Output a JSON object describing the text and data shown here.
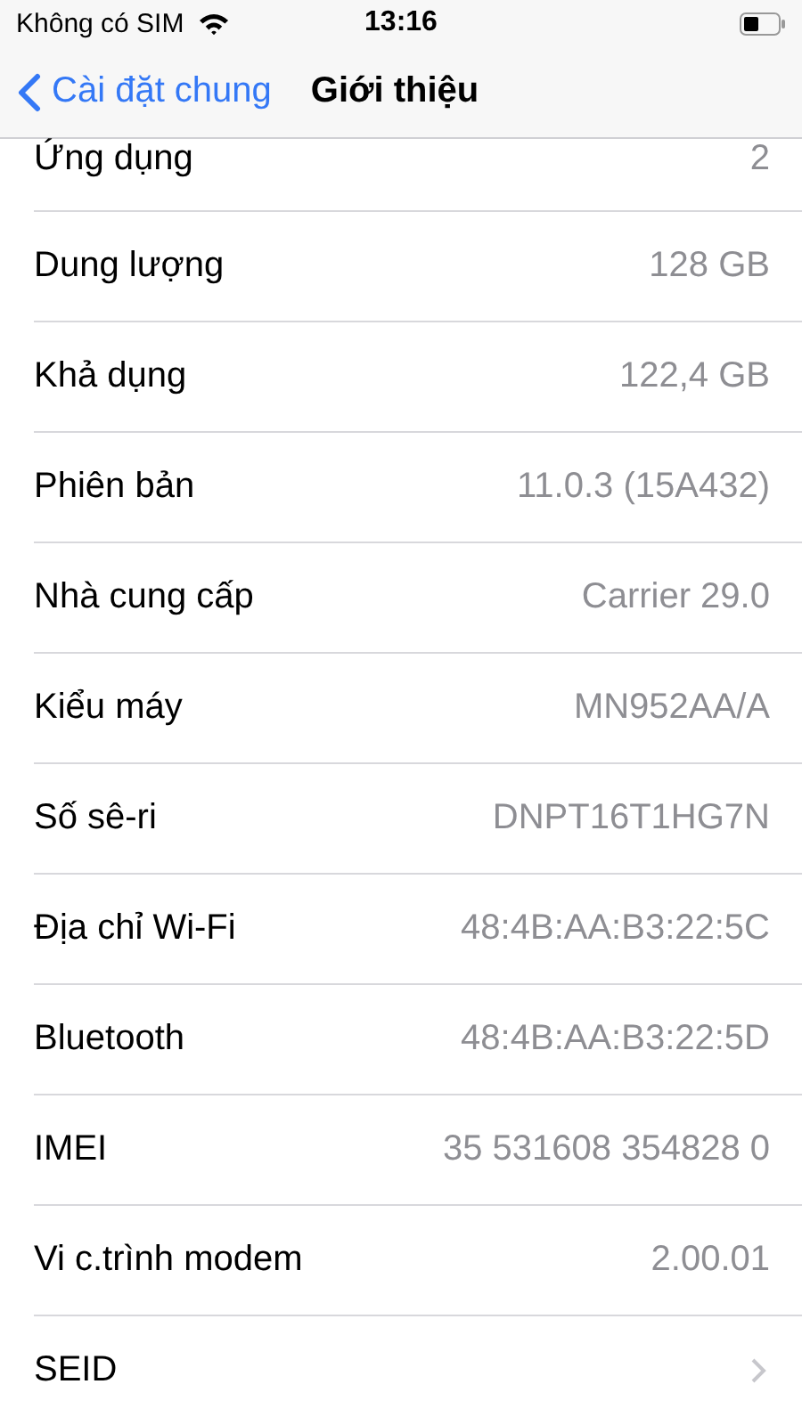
{
  "status_bar": {
    "carrier": "Không có SIM",
    "time": "13:16"
  },
  "nav": {
    "back": "Cài đặt chung",
    "title": "Giới thiệu"
  },
  "rows": [
    {
      "kind": "value",
      "label": "Ứng dụng",
      "value": "2"
    },
    {
      "kind": "value",
      "label": "Dung lượng",
      "value": "128 GB"
    },
    {
      "kind": "value",
      "label": "Khả dụng",
      "value": "122,4 GB"
    },
    {
      "kind": "value",
      "label": "Phiên bản",
      "value": "11.0.3 (15A432)"
    },
    {
      "kind": "value",
      "label": "Nhà cung cấp",
      "value": "Carrier 29.0"
    },
    {
      "kind": "value",
      "label": "Kiểu máy",
      "value": "MN952AA/A"
    },
    {
      "kind": "value",
      "label": "Số sê-ri",
      "value": "DNPT16T1HG7N"
    },
    {
      "kind": "value",
      "label": "Địa chỉ Wi-Fi",
      "value": "48:4B:AA:B3:22:5C"
    },
    {
      "kind": "value",
      "label": "Bluetooth",
      "value": "48:4B:AA:B3:22:5D"
    },
    {
      "kind": "value",
      "label": "IMEI",
      "value": "35 531608 354828 0"
    },
    {
      "kind": "value",
      "label": "Vi c.trình modem",
      "value": "2.00.01"
    },
    {
      "kind": "link",
      "label": "SEID"
    }
  ]
}
